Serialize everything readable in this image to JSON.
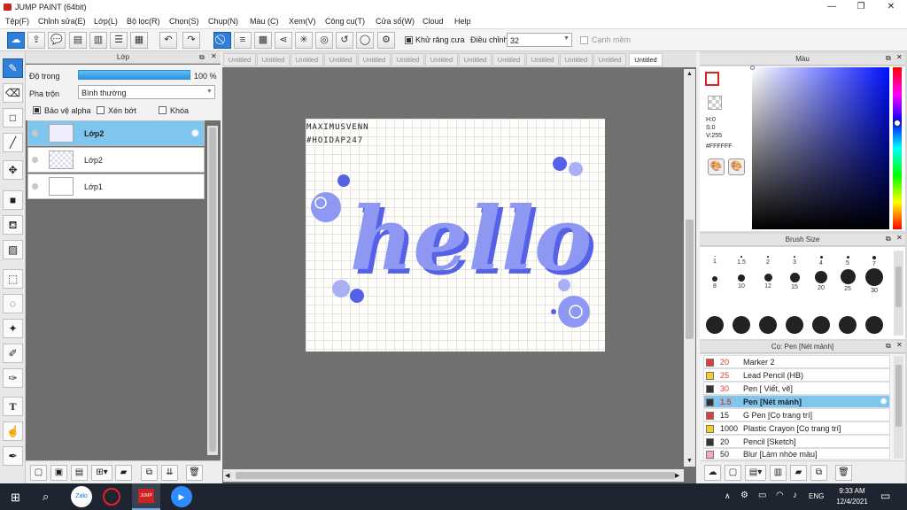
{
  "window": {
    "title": "JUMP PAINT (64bit)",
    "minimize": "—",
    "maximize": "❐",
    "close": "✕"
  },
  "menu": [
    "Tệp(F)",
    "Chỉnh sửa(E)",
    "Lớp(L)",
    "Bộ lọc(R)",
    "Chọn(S)",
    "Chụp(N)",
    "Màu (C)",
    "Xem(V)",
    "Công cụ(T)",
    "Cửa sổ(W)",
    "Cloud",
    "Help"
  ],
  "toolbar": {
    "antialias_label": "Khử răng cưa",
    "adjust_label": "Điều chỉnh",
    "adjust_value": "32",
    "smooth_label": "Cạnh mềm"
  },
  "layer_panel": {
    "title": "Lớp",
    "opacity_label": "Độ trong",
    "opacity_value": "100 %",
    "blend_label": "Pha trộn",
    "blend_value": "Bình thường",
    "protect_alpha": "Bảo vệ alpha",
    "clip": "Xén bớt",
    "lock": "Khóa",
    "layers": [
      {
        "name": "Lớp2",
        "selected": true
      },
      {
        "name": "Lớp2",
        "selected": false
      },
      {
        "name": "Lớp1",
        "selected": false
      }
    ]
  },
  "tabs": [
    "Untitled",
    "Untitled",
    "Untitled",
    "Untitled",
    "Untitled",
    "Untitled",
    "Untitled",
    "Untitled",
    "Untitled",
    "Untitled",
    "Untitled",
    "Untitled",
    "Untitled"
  ],
  "artwork": {
    "signature_line1": "MAXIMUSVENN",
    "signature_line2": "#HOIDAP247",
    "word": "hello"
  },
  "color_panel": {
    "title": "Màu",
    "h": "H:0",
    "s": "S:0",
    "v": "V:255",
    "hex": "#FFFFFF"
  },
  "brush_size": {
    "title": "Brush Size",
    "sizes": [
      "1",
      "1.5",
      "2",
      "3",
      "4",
      "5",
      "7",
      "8",
      "10",
      "12",
      "15",
      "20",
      "25",
      "30",
      "40",
      "50",
      "60",
      "80",
      "100",
      "120",
      "150"
    ]
  },
  "brush_panel": {
    "title": "Cọ: Pen [Nét mảnh]",
    "brushes": [
      {
        "size": "20",
        "name": "Marker 2",
        "color": "#e23b3b",
        "selected": false
      },
      {
        "size": "25",
        "name": "Lead Pencil (HB)",
        "color": "#f0d21e",
        "selected": false
      },
      {
        "size": "30",
        "name": "Pen [ Viết, vẽ]",
        "color": "#333333",
        "selected": false
      },
      {
        "size": "1.5",
        "name": "Pen [Nét mảnh]",
        "color": "#333333",
        "selected": true
      },
      {
        "size": "15",
        "name": "G Pen [Cọ trang trí]",
        "color": "#e23b3b",
        "selected": false
      },
      {
        "size": "1000",
        "name": "Plastic Crayon [Cọ trang trí]",
        "color": "#f0d21e",
        "selected": false
      },
      {
        "size": "20",
        "name": "Pencil [Sketch]",
        "color": "#333333",
        "selected": false
      },
      {
        "size": "50",
        "name": "Blur [Làm nhòe màu]",
        "color": "#f5a9d0",
        "selected": false
      }
    ]
  },
  "taskbar": {
    "time": "9:33 AM",
    "date": "12/4/2021",
    "lang": "ENG",
    "zalo": "Zalo",
    "jump": "JUMP"
  },
  "colors": {
    "accent": "#2f7fd8",
    "layer_selected": "#7ec6ee",
    "letter_fill": "#8e97f2",
    "letter_dark": "#5562e8",
    "canvas_bg": "#6f7070"
  }
}
